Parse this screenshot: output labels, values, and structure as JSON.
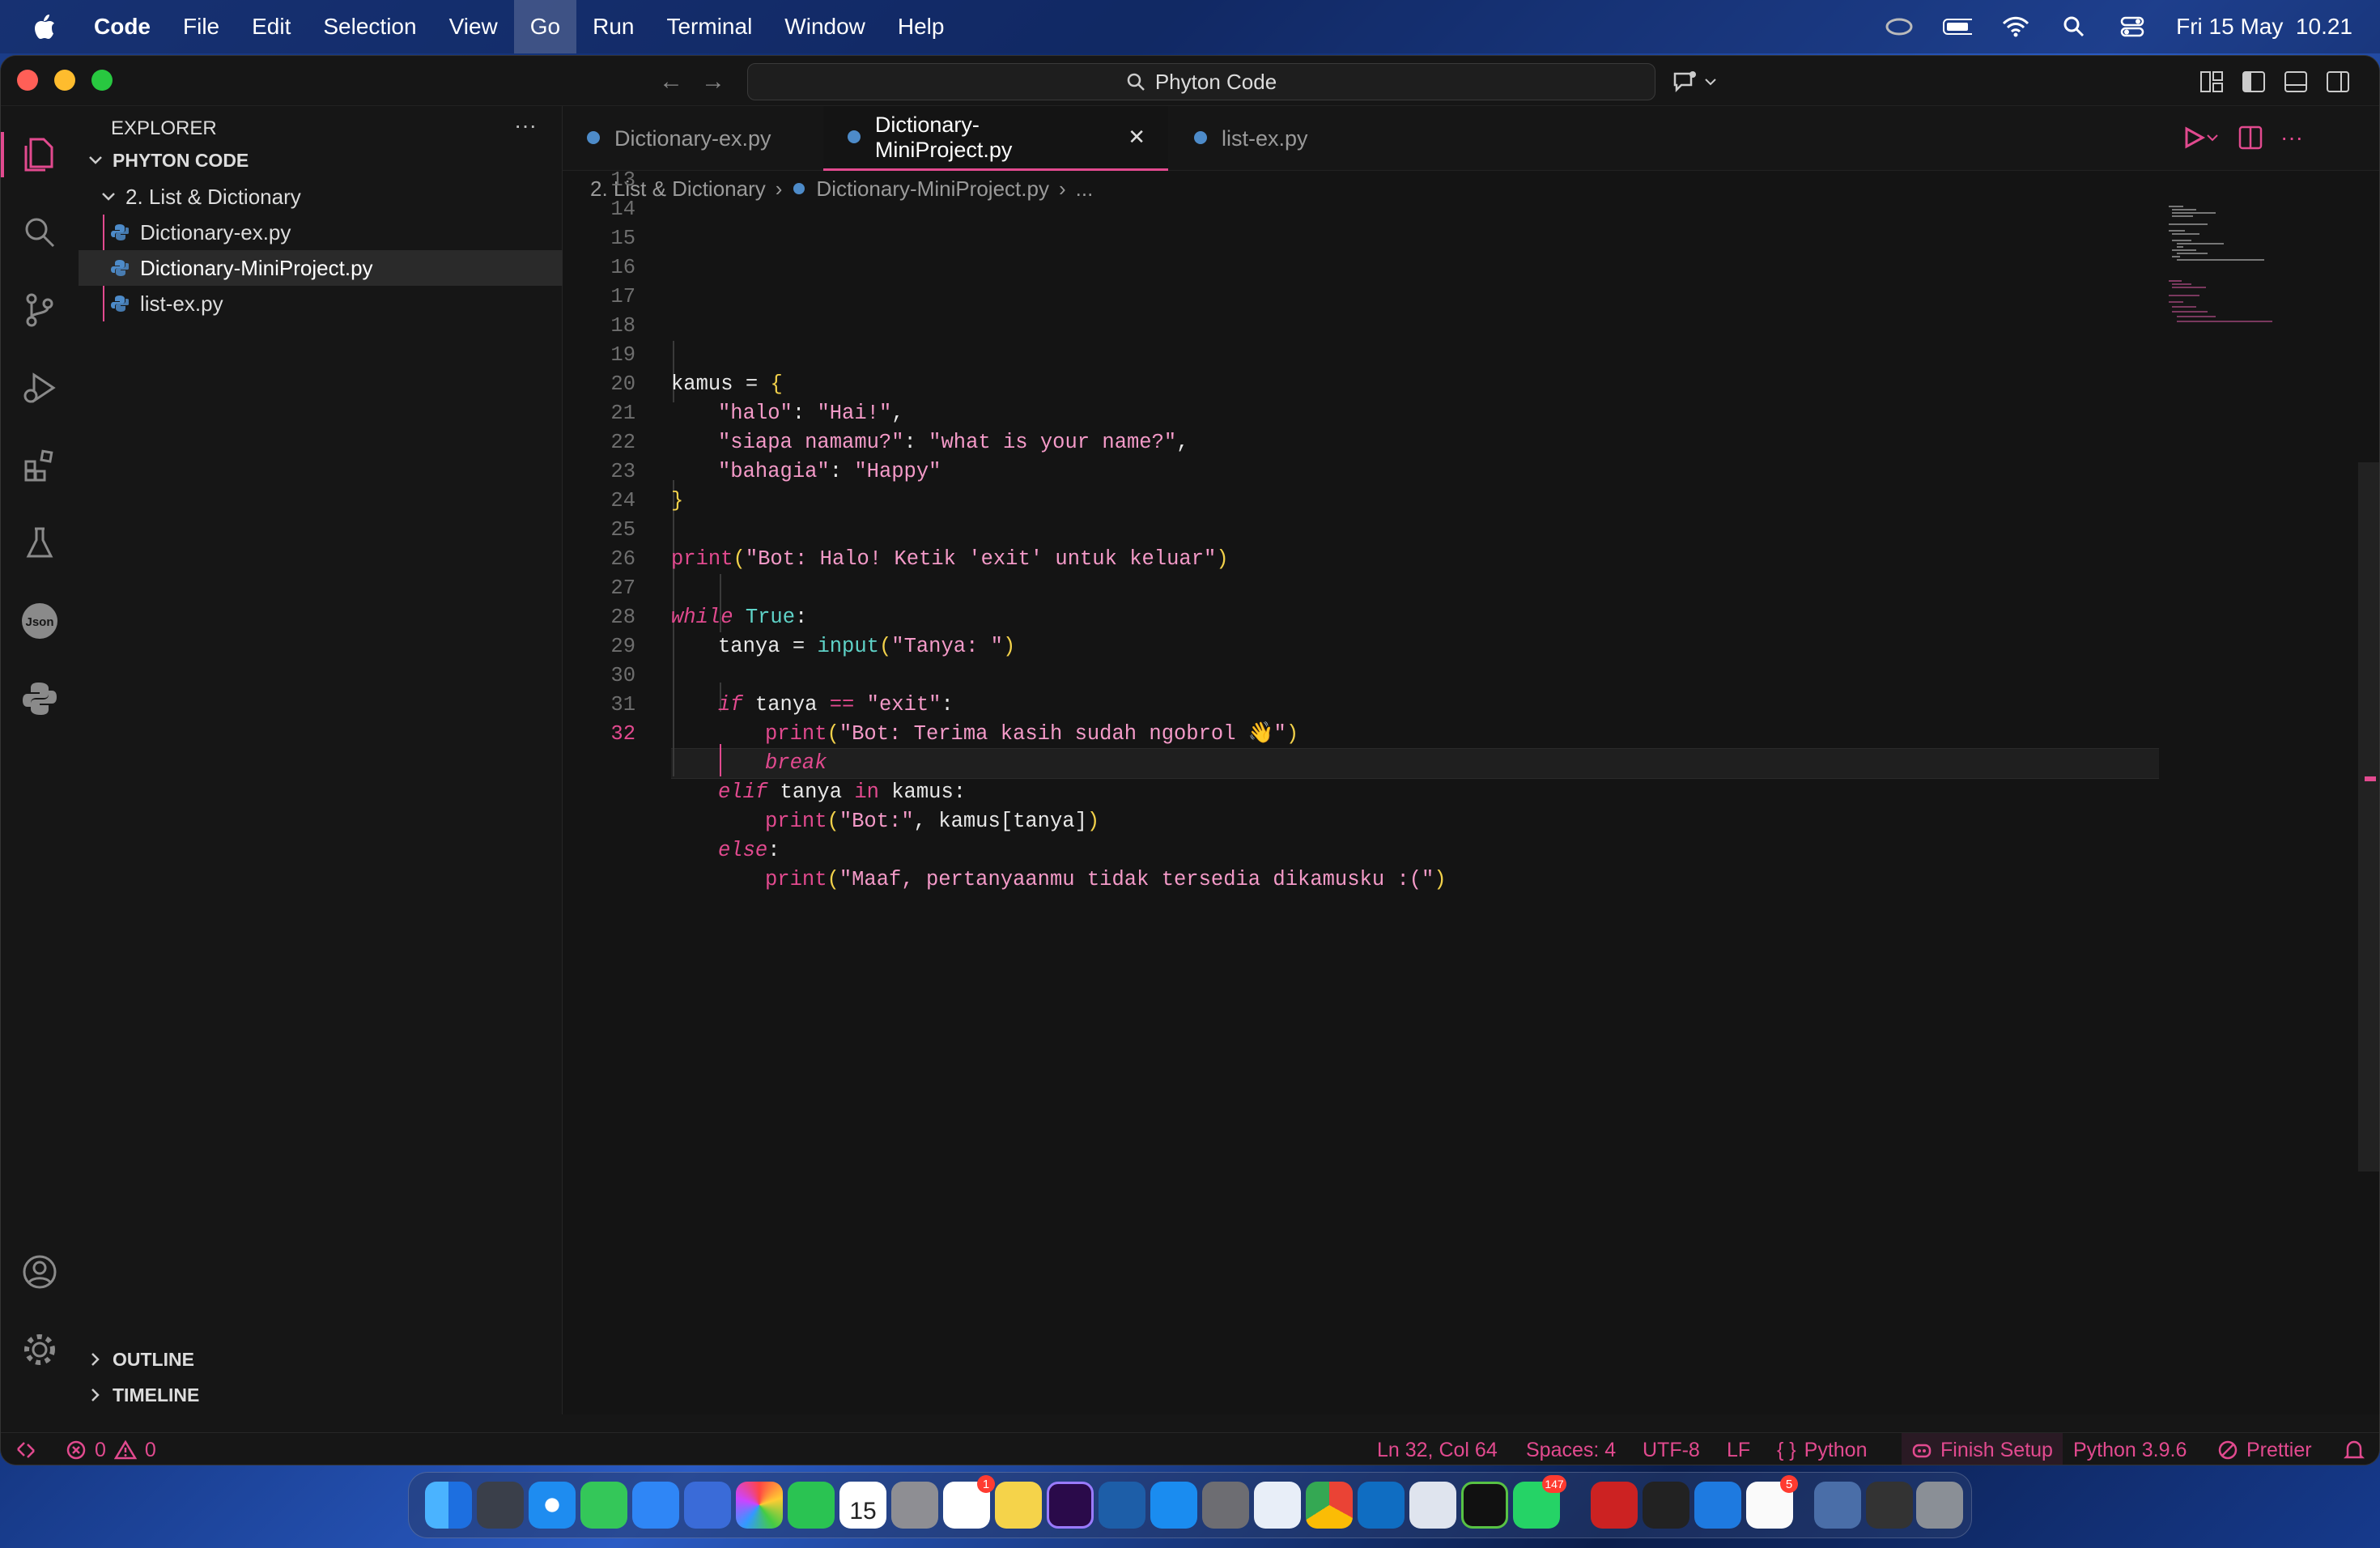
{
  "menubar": {
    "app_name": "Code",
    "items": [
      "File",
      "Edit",
      "Selection",
      "View",
      "Go",
      "Run",
      "Terminal",
      "Window",
      "Help"
    ],
    "active_item": "Go",
    "clock": "Fri 15 May  10.21"
  },
  "titlebar": {
    "search_text": "Phyton Code"
  },
  "sidebar": {
    "header": "EXPLORER",
    "more": "···",
    "root": "PHYTON CODE",
    "folder": "2. List & Dictionary",
    "files": [
      "Dictionary-ex.py",
      "Dictionary-MiniProject.py",
      "list-ex.py"
    ],
    "selected_file": "Dictionary-MiniProject.py",
    "outline": "OUTLINE",
    "timeline": "TIMELINE"
  },
  "tabs": {
    "items": [
      "Dictionary-ex.py",
      "Dictionary-MiniProject.py",
      "list-ex.py"
    ],
    "active": "Dictionary-MiniProject.py",
    "close": "✕"
  },
  "breadcrumb": {
    "folder": "2. List & Dictionary",
    "file": "Dictionary-MiniProject.py",
    "more": "..."
  },
  "code": {
    "line_numbers": [
      "13",
      "14",
      "15",
      "16",
      "17",
      "18",
      "19",
      "20",
      "21",
      "22",
      "23",
      "24",
      "25",
      "26",
      "27",
      "28",
      "29",
      "30",
      "31",
      "32"
    ],
    "current_line": "32",
    "l15": [
      "kamus",
      " = ",
      "{"
    ],
    "l16": [
      "\"halo\"",
      ": ",
      "\"Hai!\"",
      ","
    ],
    "l17": [
      "\"siapa namamu?\"",
      ": ",
      "\"what is your name?\"",
      ","
    ],
    "l18": [
      "\"bahagia\"",
      ": ",
      "\"Happy\""
    ],
    "l19": [
      "}"
    ],
    "l21": [
      "print",
      "(",
      "\"Bot: Halo! Ketik 'exit' untuk keluar\"",
      ")"
    ],
    "l23": [
      "while",
      " ",
      "True",
      ":"
    ],
    "l24": [
      "tanya",
      " = ",
      "input",
      "(",
      "\"Tanya: \"",
      ")"
    ],
    "l26": [
      "if",
      " tanya ",
      "==",
      " ",
      "\"exit\"",
      ":"
    ],
    "l27": [
      "print",
      "(",
      "\"Bot: Terima kasih sudah ngobrol 👋\"",
      ")"
    ],
    "l28": [
      "break"
    ],
    "l29": [
      "elif",
      " tanya ",
      "in",
      " kamus:"
    ],
    "l30": [
      "print",
      "(",
      "\"Bot:\"",
      ", kamus[tanya]",
      ")"
    ],
    "l31": [
      "else",
      ":"
    ],
    "l32": [
      "print",
      "(",
      "\"Maaf, pertanyaanmu tidak tersedia dikamusku :(\"",
      ")"
    ]
  },
  "statusbar": {
    "errors": "0",
    "warnings": "0",
    "position": "Ln 32, Col 64",
    "spaces": "Spaces: 4",
    "encoding": "UTF-8",
    "eol": "LF",
    "language_brace": "{ }",
    "language": "Python",
    "finish_setup": "Finish Setup",
    "interpreter": "Python 3.9.6",
    "formatter": "Prettier"
  },
  "dock": {
    "calendar_day": "15",
    "badges": {
      "reminders": "1",
      "whatsapp": "147",
      "app": "5"
    }
  },
  "colors": {
    "accent": "#e24a8f",
    "string": "#f49ac8",
    "bracket": "#f2d14a",
    "constant": "#5fd3c8"
  }
}
